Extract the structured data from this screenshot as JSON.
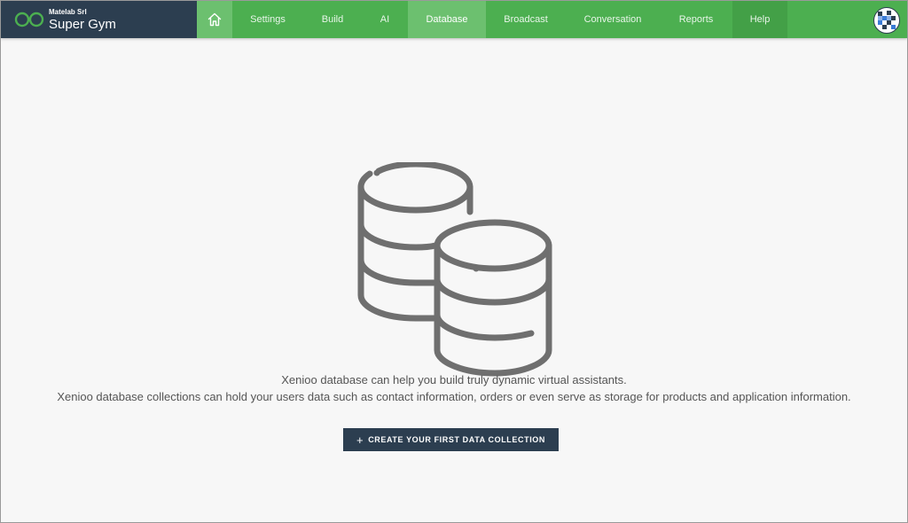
{
  "brand": {
    "company": "Matelab Srl",
    "project": "Super Gym",
    "logo_icon": "infinity-logo-icon",
    "logo_color": "#4caf50",
    "background": "#2c3e50"
  },
  "nav": {
    "home_icon": "home-icon",
    "items": [
      {
        "label": "Settings",
        "active": false
      },
      {
        "label": "Build",
        "active": false
      },
      {
        "label": "AI",
        "active": false
      },
      {
        "label": "Database",
        "active": true
      },
      {
        "label": "Broadcast",
        "active": false
      },
      {
        "label": "Conversation",
        "active": false
      },
      {
        "label": "Reports",
        "active": false
      },
      {
        "label": "Help",
        "active": false
      }
    ],
    "bar_color": "#4caf50",
    "active_color": "#6cc06f",
    "help_color": "#43a047"
  },
  "user": {
    "avatar_icon": "user-avatar-icon"
  },
  "empty_state": {
    "illustration_icon": "database-stack-icon",
    "line1": "Xenioo database can help you build truly dynamic virtual assistants.",
    "line2": "Xenioo database collections can hold your users data such as contact information, orders or even serve as storage for products and application information.",
    "cta_icon": "plus-icon",
    "cta_plus": "+",
    "cta_label": "CREATE YOUR FIRST DATA COLLECTION",
    "cta_color": "#2c3e50"
  }
}
